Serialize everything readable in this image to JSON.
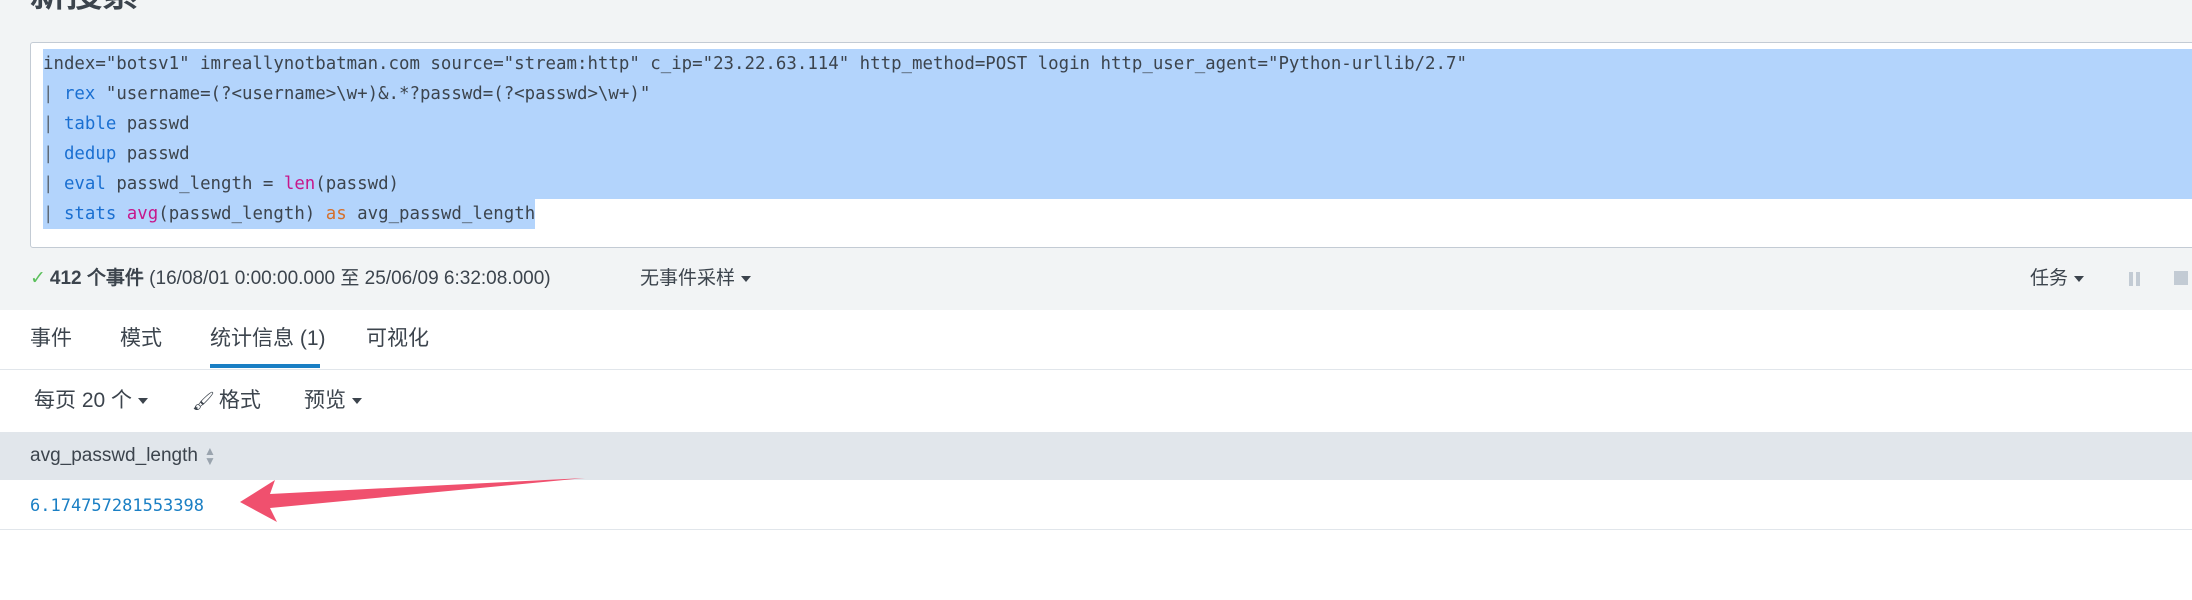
{
  "page": {
    "title": "新搜索"
  },
  "search": {
    "line1": "index=\"botsv1\" imreallynotbatman.com source=\"stream:http\" c_ip=\"23.22.63.114\" http_method=POST login http_user_agent=\"Python-urllib/2.7\"",
    "line2": {
      "pipe": "| ",
      "cmd": "rex",
      "rest": " \"username=(?<username>\\w+)&.*?passwd=(?<passwd>\\w+)\""
    },
    "line3": {
      "pipe": "| ",
      "cmd": "table",
      "rest": " passwd"
    },
    "line4": {
      "pipe": "| ",
      "cmd": "dedup",
      "rest": " passwd"
    },
    "line5": {
      "pipe": "| ",
      "cmd": "eval",
      "rest1": " passwd_length = ",
      "func": "len",
      "rest2": "(passwd)"
    },
    "line6": {
      "pipe": "| ",
      "cmd": "stats",
      "sp": " ",
      "func": "avg",
      "rest1": "(passwd_length) ",
      "as": "as",
      "rest2": " avg_passwd_length"
    }
  },
  "status": {
    "check": "✓",
    "count": "412 个事件",
    "range": " (16/08/01 0:00:00.000 至 25/06/09 6:32:08.000)",
    "sampling": "无事件采样",
    "job": "任务"
  },
  "tabs": [
    {
      "label": "事件"
    },
    {
      "label": "模式"
    },
    {
      "label": "统计信息 (1)"
    },
    {
      "label": "可视化"
    }
  ],
  "toolbar": {
    "per_page": "每页 20 个",
    "format": "格式",
    "preview": "预览"
  },
  "table": {
    "columns": [
      "avg_passwd_length"
    ],
    "rows": [
      [
        "6.174757281553398"
      ]
    ]
  },
  "colors": {
    "accent": "#1a7fc4",
    "selection": "#b3d4fc",
    "arrow": "#f0506e",
    "success": "#5cc05c"
  }
}
